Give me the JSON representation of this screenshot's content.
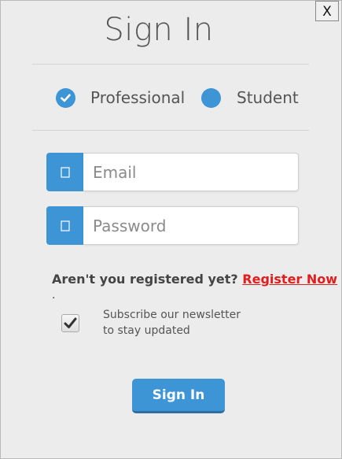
{
  "dialog": {
    "title": "Sign In",
    "close_label": "X"
  },
  "account_type": {
    "options": [
      {
        "label": "Professional",
        "selected": true
      },
      {
        "label": "Student",
        "selected": false
      }
    ]
  },
  "form": {
    "email_placeholder": "Email",
    "email_value": "",
    "password_placeholder": "Password",
    "password_value": ""
  },
  "register": {
    "prompt": "Aren't you registered yet?",
    "link_label": "Register Now",
    "trailing_dot": "."
  },
  "newsletter": {
    "line1": "Subscribe our newsletter",
    "line2": "to stay updated",
    "checked": true
  },
  "actions": {
    "submit_label": "Sign In"
  },
  "colors": {
    "accent": "#3d95d6",
    "link": "#e11d1d",
    "background": "#ececec"
  },
  "icons": {
    "email_addon": "mail-icon",
    "password_addon": "lock-icon",
    "selected_radio": "checkmark-icon",
    "checkbox": "checkmark-icon"
  }
}
